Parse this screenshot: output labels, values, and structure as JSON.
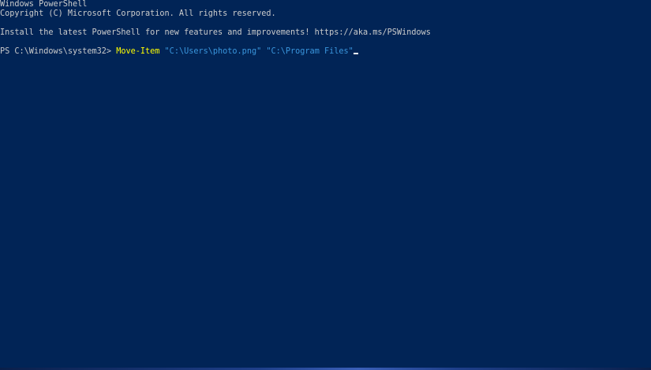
{
  "window": {
    "header_line1": "Windows PowerShell",
    "header_line2": "Copyright (C) Microsoft Corporation. All rights reserved.",
    "install_line": "Install the latest PowerShell for new features and improvements! https://aka.ms/PSWindows"
  },
  "prompt": {
    "text": "PS C:\\Windows\\system32> ",
    "command": "Move-Item",
    "arg1": "\"C:\\Users\\photo.png\"",
    "arg2": "\"C:\\Program Files\""
  },
  "colors": {
    "background": "#012456",
    "foreground": "#cccccc",
    "command": "#ffff00",
    "argument": "#3a96dd"
  }
}
